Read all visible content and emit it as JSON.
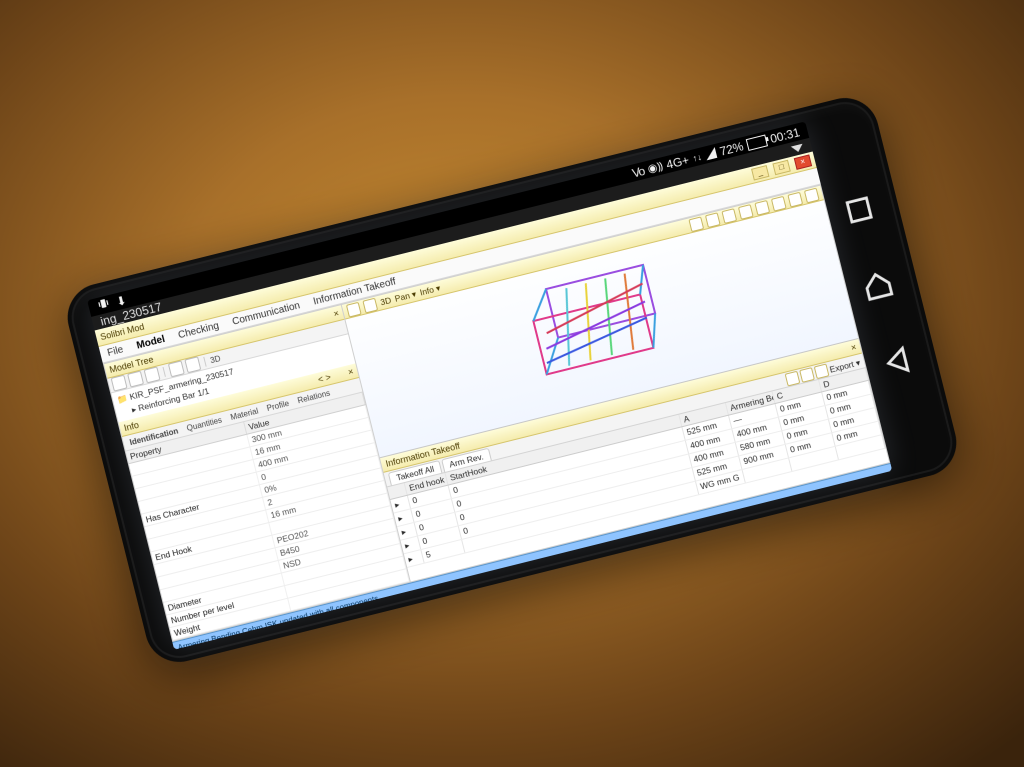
{
  "status": {
    "network_label": "4G+",
    "volte_label": "Vo",
    "battery_pct": "72%",
    "battery_fill_pct": 72,
    "clock": "00:31"
  },
  "urlbar": {
    "title": "ing_230517"
  },
  "window": {
    "title": "Solibri Mod"
  },
  "menubar": {
    "items": [
      "File",
      "Model",
      "Checking",
      "Communication",
      "Information Takeoff"
    ],
    "active": 1
  },
  "left_panel": {
    "tree_title": "Model Tree",
    "toolbar_3d": "3D",
    "tree_nodes": [
      {
        "label": "KIR_PSF_armering_230517",
        "indent": 0
      },
      {
        "label": "▸ Reinforcing Bar 1/1",
        "indent": 1
      }
    ],
    "info_title": "Info",
    "info_nav": "<  >",
    "tabs": [
      "Identification",
      "Quantities",
      "Material",
      "Profile",
      "Relations"
    ],
    "properties": [
      {
        "k": "Property",
        "v": "Value"
      },
      {
        "k": "",
        "v": "300 mm"
      },
      {
        "k": "",
        "v": "16 mm"
      },
      {
        "k": "",
        "v": "400 mm"
      },
      {
        "k": "",
        "v": "0"
      },
      {
        "k": "Has Character",
        "v": "0%"
      },
      {
        "k": "",
        "v": "2"
      },
      {
        "k": "",
        "v": "16 mm"
      },
      {
        "k": "End Hook",
        "v": ""
      },
      {
        "k": "",
        "v": "PEO202"
      },
      {
        "k": "",
        "v": "B450"
      },
      {
        "k": "",
        "v": "NSD"
      },
      {
        "k": "Diameter",
        "v": ""
      },
      {
        "k": "Number per level",
        "v": ""
      },
      {
        "k": "Weight",
        "v": ""
      }
    ]
  },
  "viewport": {
    "toolbar": [
      "3D",
      "|",
      "Pan ▾",
      "|",
      "Info ▾"
    ]
  },
  "takeoff": {
    "title": "Information Takeoff",
    "tabs_label_left": "Takeoff All",
    "tabs_label_right": "Arm Rev.",
    "export_label": "Export ▾",
    "columns": [
      "",
      "End hook",
      "StartHook",
      "A",
      "Armering Bending Ce…",
      "C",
      "D"
    ],
    "rows": [
      [
        "▸",
        "0",
        "0",
        "525 mm",
        "—",
        "0 mm",
        "0 mm"
      ],
      [
        "▸",
        "0",
        "0",
        "400 mm",
        "400 mm",
        "0 mm",
        "0 mm"
      ],
      [
        "▸",
        "0",
        "0",
        "400 mm",
        "580 mm",
        "0 mm",
        "0 mm"
      ],
      [
        "▸",
        "0",
        "0",
        "525 mm",
        "900 mm",
        "0 mm",
        "0 mm"
      ],
      [
        "▸",
        "5",
        "",
        "WG mm G",
        "",
        "",
        ""
      ]
    ]
  },
  "taskbar": {
    "items": [
      {
        "label": "",
        "icon": "explorer"
      },
      {
        "label": "",
        "icon": "chrome"
      },
      {
        "label": "Armering Bending Cehm ISK…",
        "icon": "revit"
      },
      {
        "label": "",
        "icon": "solibri",
        "active": true
      },
      {
        "label": "",
        "icon": "app"
      },
      {
        "label": "",
        "icon": "app"
      }
    ],
    "status": "Armering Bending Cehm ISK updated with all components"
  }
}
